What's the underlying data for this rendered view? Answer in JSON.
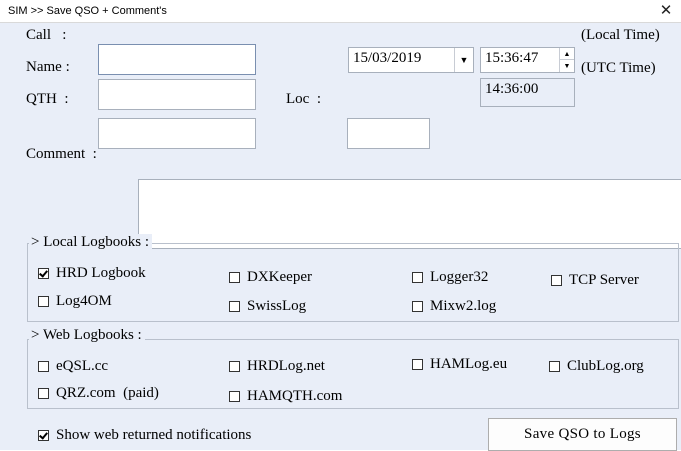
{
  "window": {
    "title": "SIM >> Save QSO + Comment's",
    "close_glyph": "✕"
  },
  "form": {
    "call_label": "Call   :",
    "name_label": "Name :",
    "qth_label": "QTH  :",
    "loc_label": "Loc  :",
    "comment_label": "Comment  :",
    "call_value": "",
    "name_value": "",
    "qth_value": "",
    "loc_value": "",
    "comment_value": ""
  },
  "datetime": {
    "date_value": "15/03/2019",
    "local_time_value": "15:36:47",
    "local_time_label": "(Local Time)",
    "utc_time_value": "14:36:00",
    "utc_time_label": "(UTC Time)"
  },
  "local_logbooks": {
    "title": "> Local Logbooks :",
    "items": [
      {
        "label": "HRD Logbook",
        "checked": true
      },
      {
        "label": "DXKeeper",
        "checked": false
      },
      {
        "label": "Logger32",
        "checked": false
      },
      {
        "label": "TCP Server",
        "checked": false
      },
      {
        "label": "Log4OM",
        "checked": false
      },
      {
        "label": "SwissLog",
        "checked": false
      },
      {
        "label": "Mixw2.log",
        "checked": false
      }
    ]
  },
  "web_logbooks": {
    "title": "> Web Logbooks :",
    "items": [
      {
        "label": "eQSL.cc",
        "checked": false
      },
      {
        "label": "HRDLog.net",
        "checked": false
      },
      {
        "label": "HAMLog.eu",
        "checked": false
      },
      {
        "label": "ClubLog.org",
        "checked": false
      },
      {
        "label": "QRZ.com  (paid)",
        "checked": false
      },
      {
        "label": "HAMQTH.com",
        "checked": false
      }
    ]
  },
  "footer": {
    "show_notifications_label": "Show web returned notifications",
    "show_notifications_checked": true,
    "save_button_label": "Save  QSO  to  Logs"
  },
  "icons": {
    "dropdown": "chevron-down-icon",
    "spin_up": "spin-up-icon",
    "spin_down": "spin-down-icon",
    "close": "close-icon"
  }
}
